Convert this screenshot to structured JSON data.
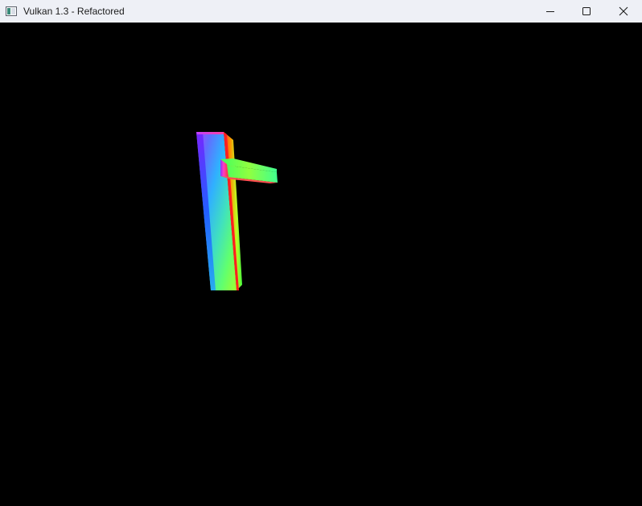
{
  "window": {
    "title": "Vulkan 1.3 - Refactored",
    "background_color": "#000000",
    "titlebar_color": "#eef0f6"
  },
  "titlebar": {
    "app_icon": "window-app-icon",
    "buttons": [
      {
        "name": "minimize",
        "icon": "minimize-icon"
      },
      {
        "name": "maximize",
        "icon": "maximize-icon"
      },
      {
        "name": "close",
        "icon": "close-icon"
      }
    ]
  },
  "scene": {
    "description_icon": "rendered-3d-mesh",
    "shading": "rainbow-normals"
  }
}
